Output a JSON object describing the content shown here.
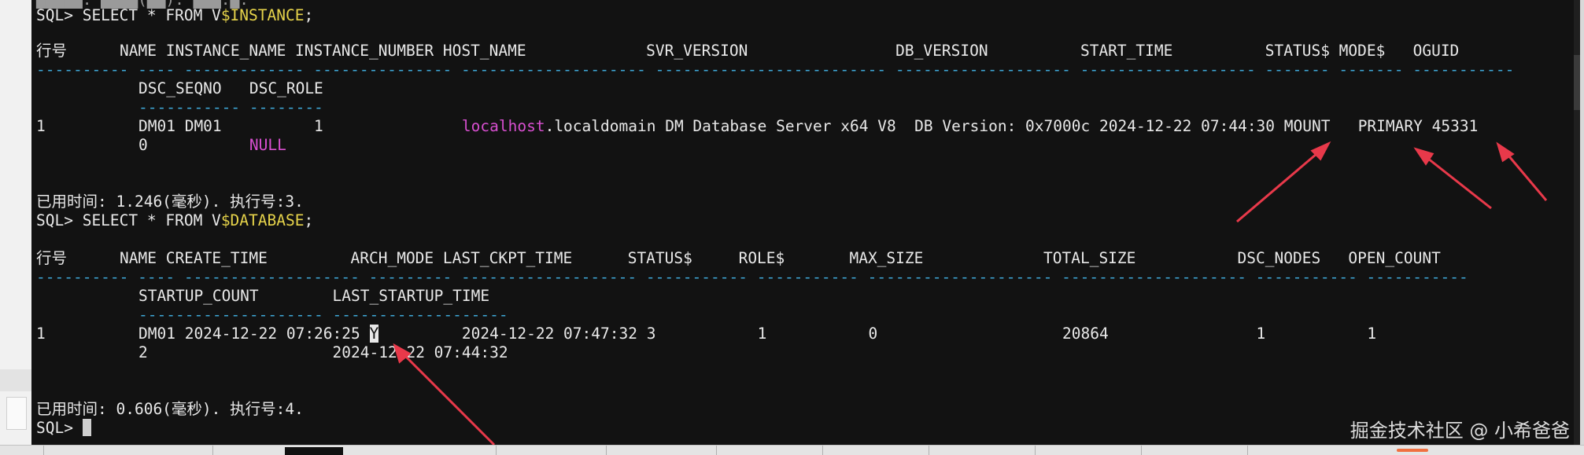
{
  "terminal": {
    "l_top": "SQL> SELECT * FROM V",
    "l_top_var": "$INSTANCE",
    "l_top_end": ";",
    "instance": {
      "h_rownum": "行号",
      "h_rest": "NAME INSTANCE_NAME INSTANCE_NUMBER HOST_NAME             SVR_VERSION                DB_VERSION          START_TIME          STATUS$ MODE$   OGUID",
      "dash1": "---------- ---- ------------- --------------- -------------------- ------------------------- ------------------- ------------------- ------- ------- -----------",
      "h2": "DSC_SEQNO   DSC_ROLE",
      "dash2": "----------- --------",
      "r1_rownum": "1",
      "r1_a": "DM01 DM01          1               ",
      "r1_host": "localhost",
      "r1_b": ".localdomain DM Database Server x64 V8  DB Version: 0x7000c 2024-12-22 07:44:30 MOUNT   PRIMARY 45331",
      "r2_seq": "0",
      "r2_role": "NULL"
    },
    "elapsed1": "已用时间: 1.246(毫秒). 执行号:3.",
    "l_db": "SQL> SELECT * FROM V",
    "l_db_var": "$DATABASE",
    "l_db_end": ";",
    "database": {
      "h_rownum": "行号",
      "h_rest": "NAME CREATE_TIME         ARCH_MODE LAST_CKPT_TIME      STATUS$     ROLE$       MAX_SIZE             TOTAL_SIZE           DSC_NODES   OPEN_COUNT",
      "dash1": "---------- ---- ------------------- --------- ------------------- ----------- ----------- -------------------- -------------------- ----------- -----------",
      "h2": "STARTUP_COUNT        LAST_STARTUP_TIME",
      "dash2": "-------------------- -------------------",
      "r1_rownum": "1",
      "r1_a": "DM01 2024-12-22 07:26:25 ",
      "r1_arch": "Y",
      "r1_b": "         2024-12-22 07:47:32 3           1           0                    20864                1           1",
      "r2_a": "2                    ",
      "r2_b": "2024-12-22 07:44:32"
    },
    "elapsed2": "已用时间: 0.606(毫秒). 执行号:4.",
    "prompt": "SQL> "
  },
  "watermark": "掘金技术社区 @ 小希爸爸",
  "colors": {
    "background": "#121212",
    "text": "#e8e8e8",
    "keyword_yellow": "#e6d34a",
    "null_magenta": "#d84fd0",
    "separator_cyan": "#3ea7d6",
    "arrow_red": "#e8394a"
  }
}
